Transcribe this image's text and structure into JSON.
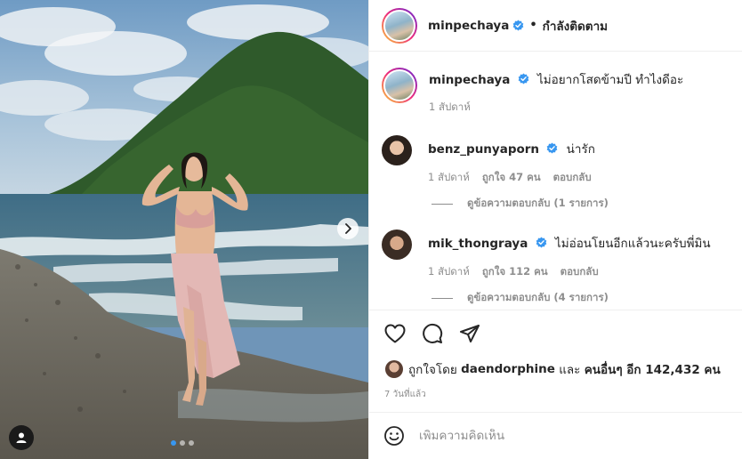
{
  "post": {
    "photo_alt": "photo",
    "carousel_count": 3,
    "carousel_active": 0
  },
  "header": {
    "username": "minpechaya",
    "separator": "•",
    "follow_label": "กำลังติดตาม"
  },
  "comments": [
    {
      "username": "minpechaya",
      "text": "ไม่อยากโสดข้ามปี ทำไงดีอะ",
      "time": "1 สัปดาห์",
      "likes": "",
      "reply_label": ""
    },
    {
      "username": "benz_punyaporn",
      "text": "น่ารัก",
      "time": "1 สัปดาห์",
      "likes": "ถูกใจ 47 คน",
      "reply_label": "ตอบกลับ",
      "view_replies": "ดูข้อความตอบกลับ (1 รายการ)"
    },
    {
      "username": "mik_thongraya",
      "text": "ไม่อ่อนโยนอีกแล้วนะครับพี่มิน",
      "time": "1 สัปดาห์",
      "likes": "ถูกใจ 112 คน",
      "reply_label": "ตอบกลับ",
      "view_replies": "ดูข้อความตอบกลับ (4 รายการ)"
    }
  ],
  "likes": {
    "prefix": "ถูกใจโดย",
    "user": "daendorphine",
    "conj": "และ",
    "others": "คนอื่นๆ อีก 142,432 คน"
  },
  "time_ago": "7 วันที่แล้ว",
  "add_comment": {
    "placeholder": "เพิ่มความคิดเห็น"
  },
  "colors": {
    "verified": "#3897f0",
    "text": "#262626",
    "muted": "#8e8e8e",
    "divider": "#efefef"
  }
}
